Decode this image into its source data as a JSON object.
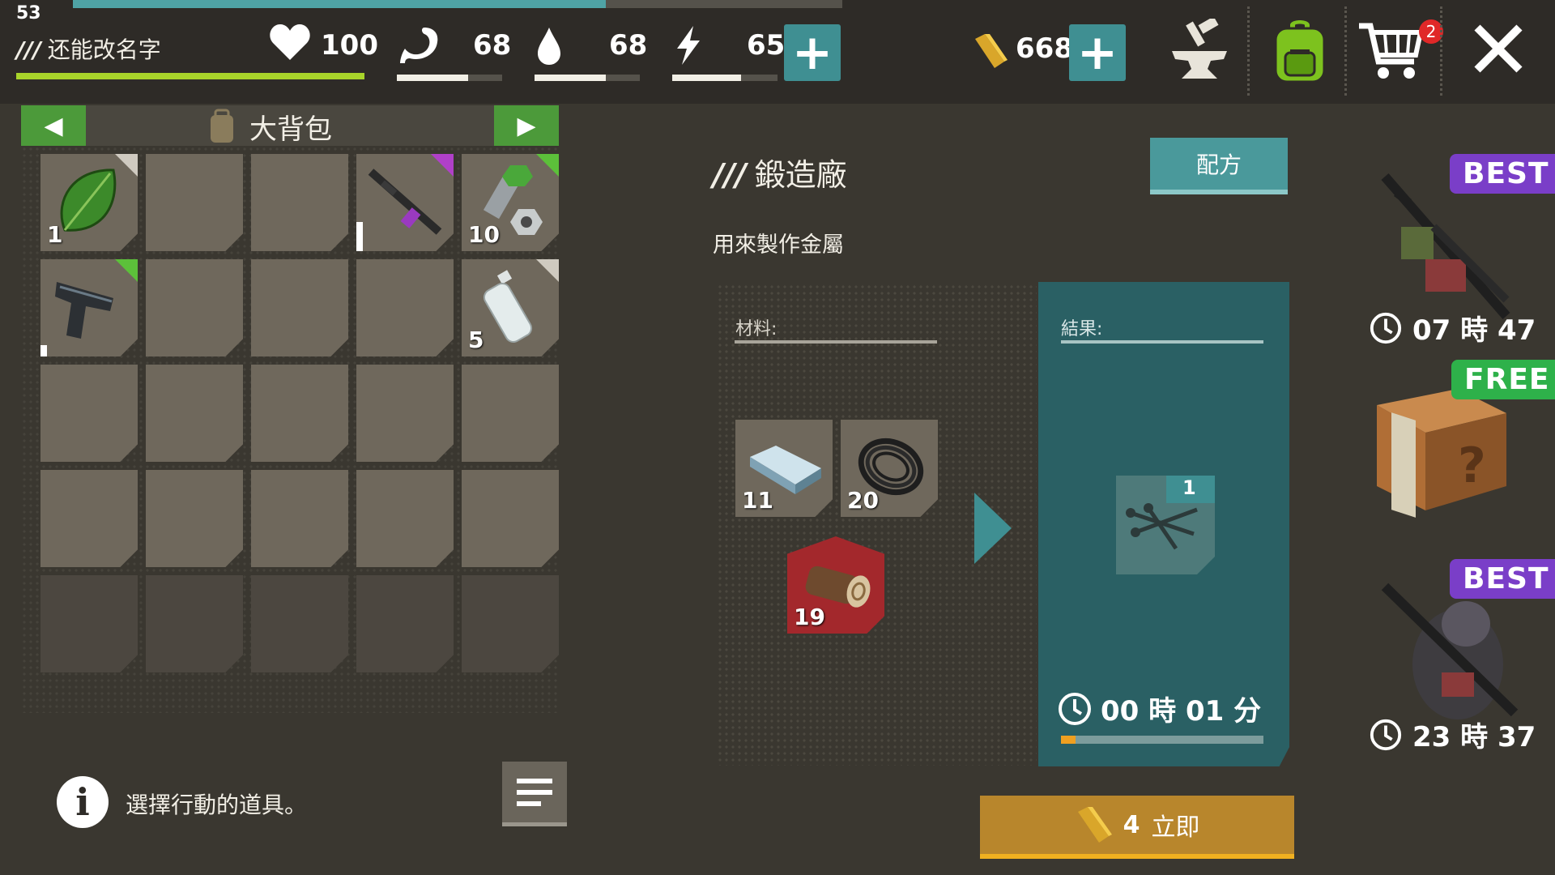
{
  "hud": {
    "level": "53",
    "player_name": "还能改名字",
    "name_prefix": "///",
    "health": {
      "icon": "heart-icon",
      "value": "100",
      "fill": 1.0
    },
    "food": {
      "icon": "stomach-icon",
      "value": "68",
      "fill": 0.68
    },
    "water": {
      "icon": "water-drop-icon",
      "value": "68",
      "fill": 0.68
    },
    "energy": {
      "icon": "lightning-icon",
      "value": "65",
      "fill": 0.65
    },
    "gold": {
      "icon": "gold-bar-icon",
      "value": "668"
    },
    "plus": "+",
    "xp_fill": 0.69,
    "cart_badge": "2",
    "close": "✕"
  },
  "backpack": {
    "title": "大背包",
    "prev": "◀",
    "next": "▶",
    "items": [
      {
        "slot": 0,
        "icon": "leaf-icon",
        "count": "1",
        "corner": "#cfcac0"
      },
      {
        "slot": 3,
        "icon": "assault-rifle-icon",
        "count": "",
        "corner": "#b040c8"
      },
      {
        "slot": 4,
        "icon": "bolt-nut-icon",
        "count": "10",
        "corner": "#5cc03a"
      },
      {
        "slot": 5,
        "icon": "pistol-icon",
        "count": "",
        "corner": "#5cc03a"
      },
      {
        "slot": 9,
        "icon": "bottle-icon",
        "count": "5",
        "corner": "#cfcac0"
      }
    ]
  },
  "info": {
    "text": "選擇行動的道具。"
  },
  "forge": {
    "title": "鍛造廠",
    "prefix": "///",
    "recipe_button": "配方",
    "description": "用來製作金屬",
    "materials_label": "材料:",
    "result_label": "結果:",
    "materials": [
      {
        "icon": "metal-bar-icon",
        "count": "11"
      },
      {
        "icon": "wire-coil-icon",
        "count": "20"
      },
      {
        "icon": "wood-log-icon",
        "count": "19",
        "missing": true
      }
    ],
    "result": {
      "icon": "nails-icon",
      "count": "1"
    },
    "timer": "00 時 01 分",
    "progress": 0.07,
    "instant_cost": "4",
    "instant_label": "立即"
  },
  "offers": [
    {
      "badge": "BEST",
      "timer": "07 時 47",
      "icon": "rifle-bundle-icon"
    },
    {
      "badge": "FREE",
      "icon": "mystery-box-icon"
    },
    {
      "badge": "BEST",
      "timer": "23 時 37",
      "icon": "armored-soldier-icon"
    }
  ],
  "colors": {
    "accent": "#3f8f92",
    "green": "#4c9a3a",
    "gold": "#b8862c",
    "best": "#7a3ec8",
    "free": "#2eb14a"
  }
}
